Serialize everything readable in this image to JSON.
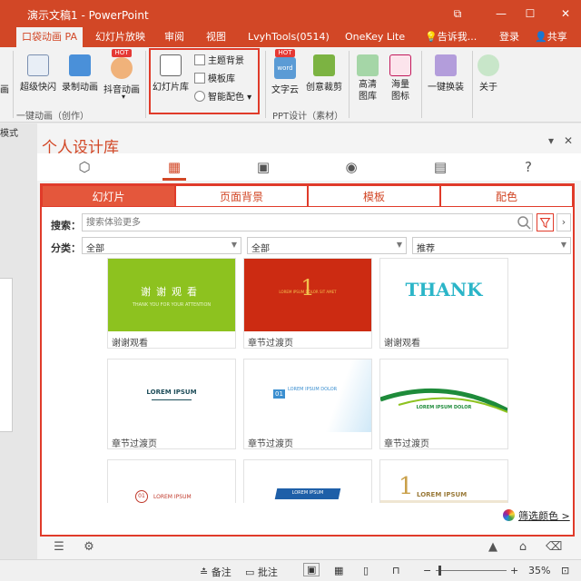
{
  "window": {
    "title": "演示文稿1 - PowerPoint",
    "controls": [
      "⧉",
      "—",
      "☐",
      "✕"
    ]
  },
  "tabs": [
    {
      "label": "口袋动画 PA",
      "active": true
    },
    {
      "label": "幻灯片放映"
    },
    {
      "label": "审阅"
    },
    {
      "label": "视图"
    },
    {
      "label": "LvyhTools(0514)"
    },
    {
      "label": "OneKey Lite"
    },
    {
      "label": "告诉我..."
    },
    {
      "label": "登录"
    },
    {
      "label": "共享"
    }
  ],
  "ribbon": {
    "edge_label": "画",
    "buttons": {
      "super_flash": "超级快闪",
      "record_anim": "录制动画",
      "douyin_anim": "抖音动画",
      "slide_lib": "幻灯片库",
      "theme_bg": "主题背景",
      "template_lib": "模板库",
      "smart_color": "智能配色",
      "word_cloud": "文字云",
      "creative_crop": "创意裁剪",
      "hd_image": "高清图库",
      "massive_icons": "海量图标",
      "one_click": "一键换装",
      "about": "关于"
    },
    "badges": {
      "hot1": "HOT",
      "hot2": "HOT",
      "word": "word"
    },
    "groups": {
      "one_click_anim": "一键动画（创作）",
      "ppt_design": "PPT设计（素材）"
    }
  },
  "leftpane": {
    "mode": "模式"
  },
  "panel": {
    "title": "个人设计库",
    "close": "✕",
    "collapse": "▾",
    "subtabs": [
      "幻灯片",
      "页面背景",
      "模板",
      "配色"
    ],
    "search_label": "搜索：",
    "search_placeholder": "搜索体验更多",
    "category_label": "分类：",
    "dropdowns": [
      "全部",
      "全部",
      "推荐"
    ],
    "next": "›",
    "cards": [
      {
        "caption": "谢谢观看",
        "thumb_text": "谢谢观看",
        "thumb_sub": "THANK YOU FOR YOUR ATTENTION"
      },
      {
        "caption": "章节过渡页",
        "thumb_text": "1",
        "thumb_sub": "LOREM IPSUM DOLOR SIT AMET"
      },
      {
        "caption": "谢谢观看",
        "thumb_text": "THANK",
        "thumb_sub": ""
      },
      {
        "caption": "章节过渡页",
        "thumb_text": "LOREM IPSUM",
        "thumb_sub": ""
      },
      {
        "caption": "章节过渡页",
        "thumb_text": "LOREM IPSUM DOLOR",
        "thumb_sub": "01"
      },
      {
        "caption": "章节过渡页",
        "thumb_text": "LOREM IPSUM DOLOR",
        "thumb_sub": ""
      },
      {
        "caption": "",
        "thumb_text": "LOREM IPSUM",
        "thumb_sub": "01"
      },
      {
        "caption": "",
        "thumb_text": "LOREM IPSUM",
        "thumb_sub": ""
      },
      {
        "caption": "",
        "thumb_text": "LOREM IPSUM",
        "thumb_sub": "1"
      }
    ],
    "color_filter": "筛选颜色 >"
  },
  "statusbar": {
    "notes": "备注",
    "comments": "批注",
    "zoom_minus": "−",
    "zoom_plus": "+",
    "zoom": "35%",
    "zoom_level": 0.35
  },
  "colors": {
    "accent": "#d24726",
    "frame": "#e03b2a"
  }
}
